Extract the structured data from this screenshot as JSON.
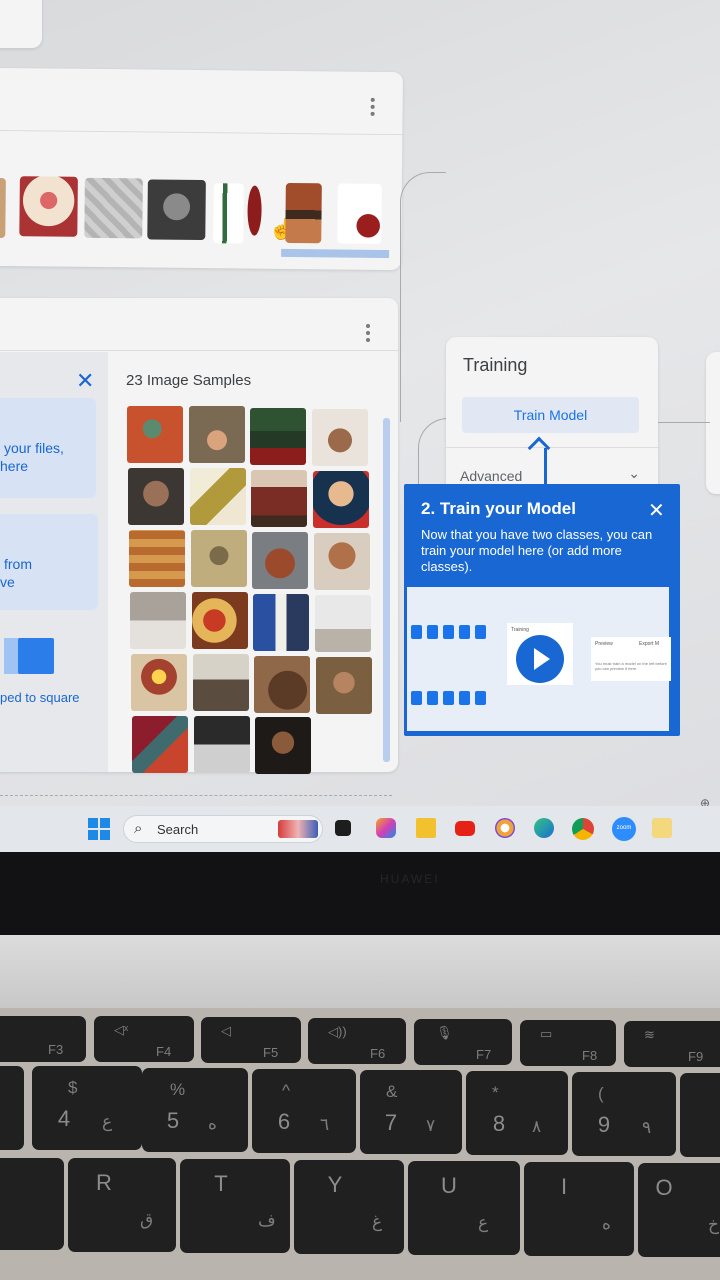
{
  "dataset_card": {
    "samples_title": "23 Image Samples",
    "upload_text_1": "your files,",
    "upload_text_2": "here",
    "webcam_text_1": "from",
    "webcam_text_2": "ve",
    "crop_text": "ped to square"
  },
  "training_card": {
    "title": "Training",
    "train_button": "Train Model",
    "advanced_label": "Advanced"
  },
  "tutorial": {
    "title": "2. Train your Model",
    "body": "Now that you have two classes, you can train your model here (or add more classes).",
    "video_training_label": "Training",
    "video_preview_label": "Preview",
    "video_export_label": "Export M",
    "video_hint": "You must train a model on the left before you can preview it here."
  },
  "taskbar": {
    "search_placeholder": "Search",
    "zoom_label": "zoom"
  },
  "laptop": {
    "brand": "HUAWEI",
    "fn_row": [
      "F3",
      "F4",
      "F5",
      "F6",
      "F7",
      "F8",
      "F9"
    ],
    "number_row": [
      {
        "main": "4",
        "shift": "$",
        "alt": "ع"
      },
      {
        "main": "5",
        "shift": "%",
        "alt": "ه"
      },
      {
        "main": "6",
        "shift": "^",
        "alt": "٦"
      },
      {
        "main": "7",
        "shift": "&",
        "alt": "٧"
      },
      {
        "main": "8",
        "shift": "*",
        "alt": "٨"
      },
      {
        "main": "9",
        "shift": "(",
        "alt": "٩"
      }
    ],
    "letter_row": [
      {
        "main": "R",
        "alt": "ق"
      },
      {
        "main": "T",
        "alt": "ف"
      },
      {
        "main": "Y",
        "alt": "غ"
      },
      {
        "main": "U",
        "alt": "ع"
      },
      {
        "main": "I",
        "alt": "ه"
      },
      {
        "main": "O",
        "alt": "خ"
      }
    ]
  },
  "colors": {
    "accent_blue": "#1967d2",
    "train_button_bg": "#e1e8f3",
    "train_button_text": "#1a73e8"
  }
}
